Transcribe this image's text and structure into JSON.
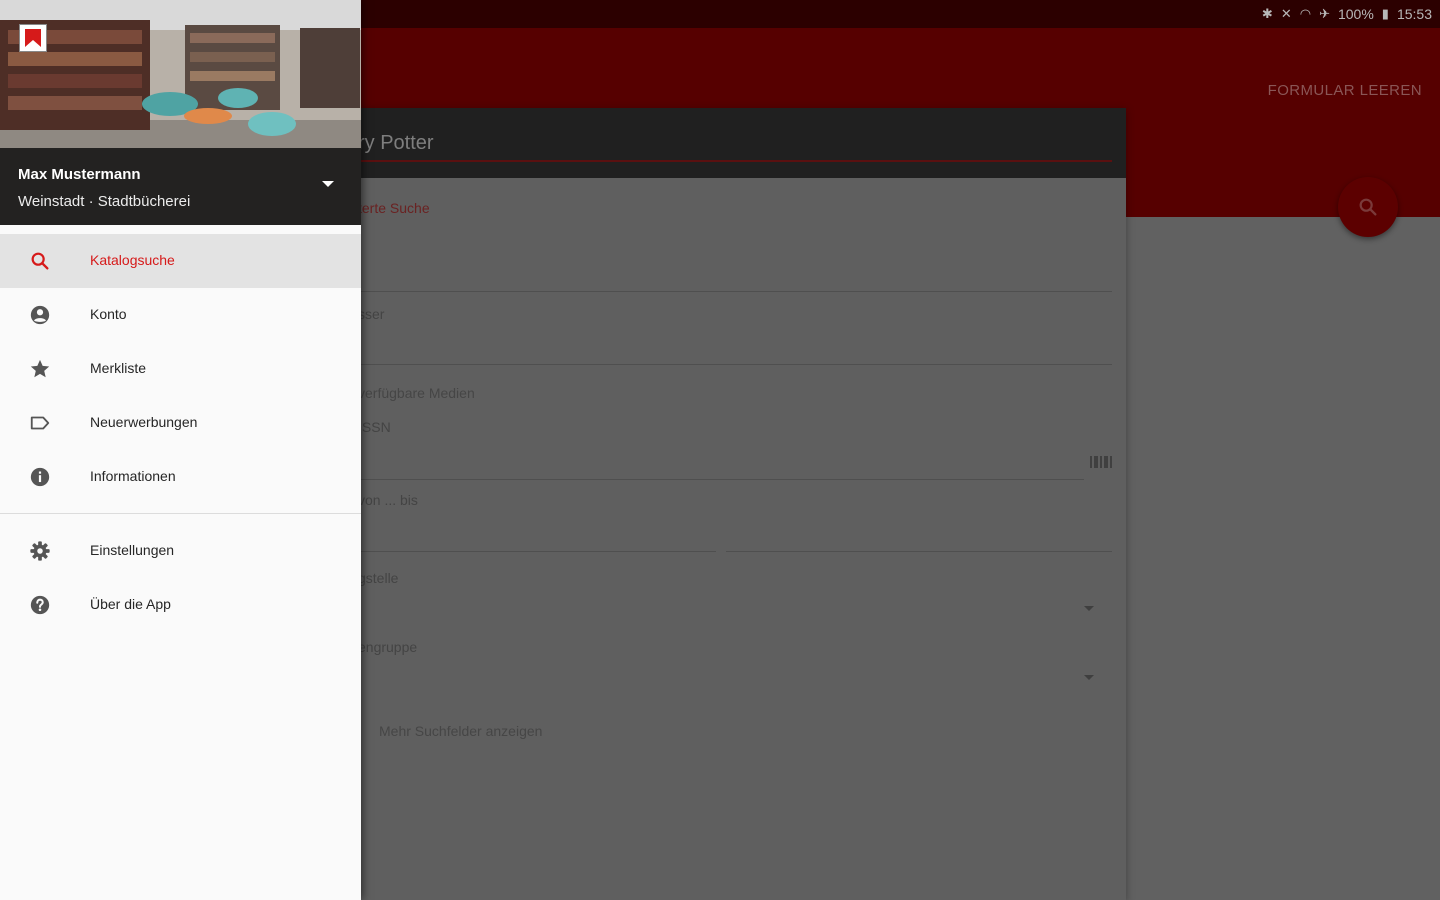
{
  "status": {
    "battery": "100%",
    "time": "15:53"
  },
  "toolbar": {
    "clear_label": "FORMULAR LEEREN"
  },
  "search": {
    "query_fragment": "ry Potter",
    "advanced_fragment": "terte Suche"
  },
  "form": {
    "author_fragment": "sser",
    "available_fragment": "verfügbare Medien",
    "issn_fragment": "ISSN",
    "year_fragment": "von ... bis",
    "branch_fragment": "gstelle",
    "mediagroup_fragment": "engruppe",
    "more_fields": "Mehr Suchfelder anzeigen"
  },
  "drawer": {
    "user_name": "Max Mustermann",
    "library": "Weinstadt · Stadtbücherei",
    "items": [
      {
        "label": "Katalogsuche",
        "icon": "search-icon",
        "active": true
      },
      {
        "label": "Konto",
        "icon": "account-circle-icon",
        "active": false
      },
      {
        "label": "Merkliste",
        "icon": "star-icon",
        "active": false
      },
      {
        "label": "Neuerwerbungen",
        "icon": "label-outline-icon",
        "active": false
      },
      {
        "label": "Informationen",
        "icon": "info-icon",
        "active": false
      }
    ],
    "secondary_items": [
      {
        "label": "Einstellungen",
        "icon": "settings-icon"
      },
      {
        "label": "Über die App",
        "icon": "help-icon"
      }
    ]
  },
  "colors": {
    "accent": "#d61a1a",
    "primary": "#8b0000"
  }
}
